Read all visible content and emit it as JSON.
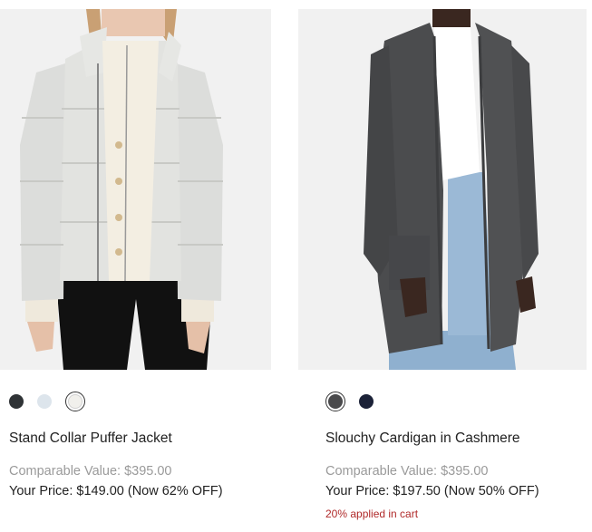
{
  "products": [
    {
      "name": "Stand Collar Puffer Jacket",
      "comparable_value": "Comparable Value: $395.00",
      "your_price": "Your Price: $149.00 (Now 62% OFF)",
      "swatches": [
        {
          "color": "#2f3336",
          "selected": false
        },
        {
          "color": "#dde5ec",
          "selected": false
        },
        {
          "color": "#f1f0ec",
          "selected": true
        }
      ],
      "image_icon": "puffer-jacket-photo"
    },
    {
      "name": "Slouchy Cardigan in Cashmere",
      "comparable_value": "Comparable Value: $395.00",
      "your_price": "Your Price: $197.50 (Now 50% OFF)",
      "promo": "20% applied in cart",
      "swatches": [
        {
          "color": "#4a4a4c",
          "selected": true
        },
        {
          "color": "#1c2238",
          "selected": false
        }
      ],
      "image_icon": "cashmere-cardigan-photo"
    }
  ],
  "colors": {
    "promo": "#b02a2a",
    "muted": "#9a9a9a",
    "text": "#222222"
  }
}
